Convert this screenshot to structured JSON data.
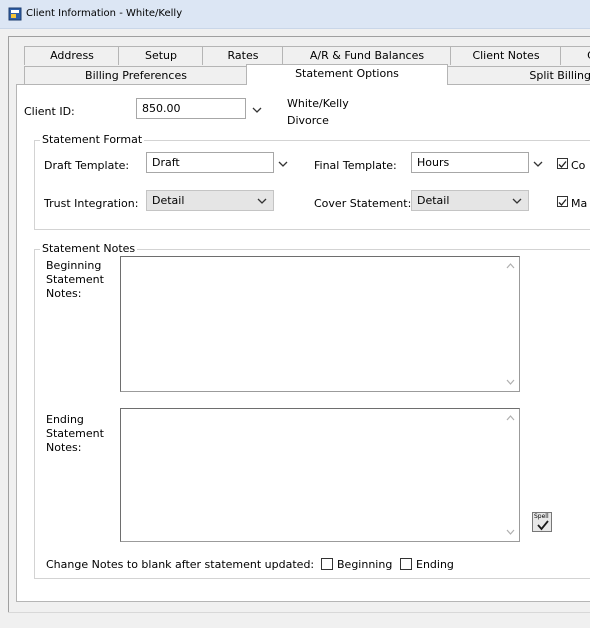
{
  "window": {
    "title": "Client Information - White/Kelly"
  },
  "tabs_row1": [
    {
      "label": "Address"
    },
    {
      "label": "Setup"
    },
    {
      "label": "Rates"
    },
    {
      "label": "A/R & Fund Balances"
    },
    {
      "label": "Client Notes"
    },
    {
      "label": "C"
    }
  ],
  "tabs_row2": [
    {
      "label": "Billing Preferences"
    },
    {
      "label": "Statement Options"
    },
    {
      "label": "Split Billing"
    }
  ],
  "client": {
    "id_label": "Client ID:",
    "id_value": "850.00",
    "name": "White/Kelly",
    "matter": "Divorce"
  },
  "statement_format": {
    "title": "Statement Format",
    "draft_label": "Draft Template:",
    "draft_value": "Draft",
    "final_label": "Final Template:",
    "final_value": "Hours",
    "trust_label": "Trust Integration:",
    "trust_value": "Detail",
    "cover_label": "Cover Statement:",
    "cover_value": "Detail",
    "check1_label": "Co",
    "check2_label": "Ma"
  },
  "statement_notes": {
    "title": "Statement Notes",
    "beginning_label": [
      "Beginning",
      "Statement",
      "Notes:"
    ],
    "ending_label": [
      "Ending",
      "Statement",
      "Notes:"
    ],
    "spell_label": "Spell",
    "change_label": "Change Notes to blank after statement updated:",
    "beginning_check": "Beginning",
    "ending_check": "Ending"
  }
}
